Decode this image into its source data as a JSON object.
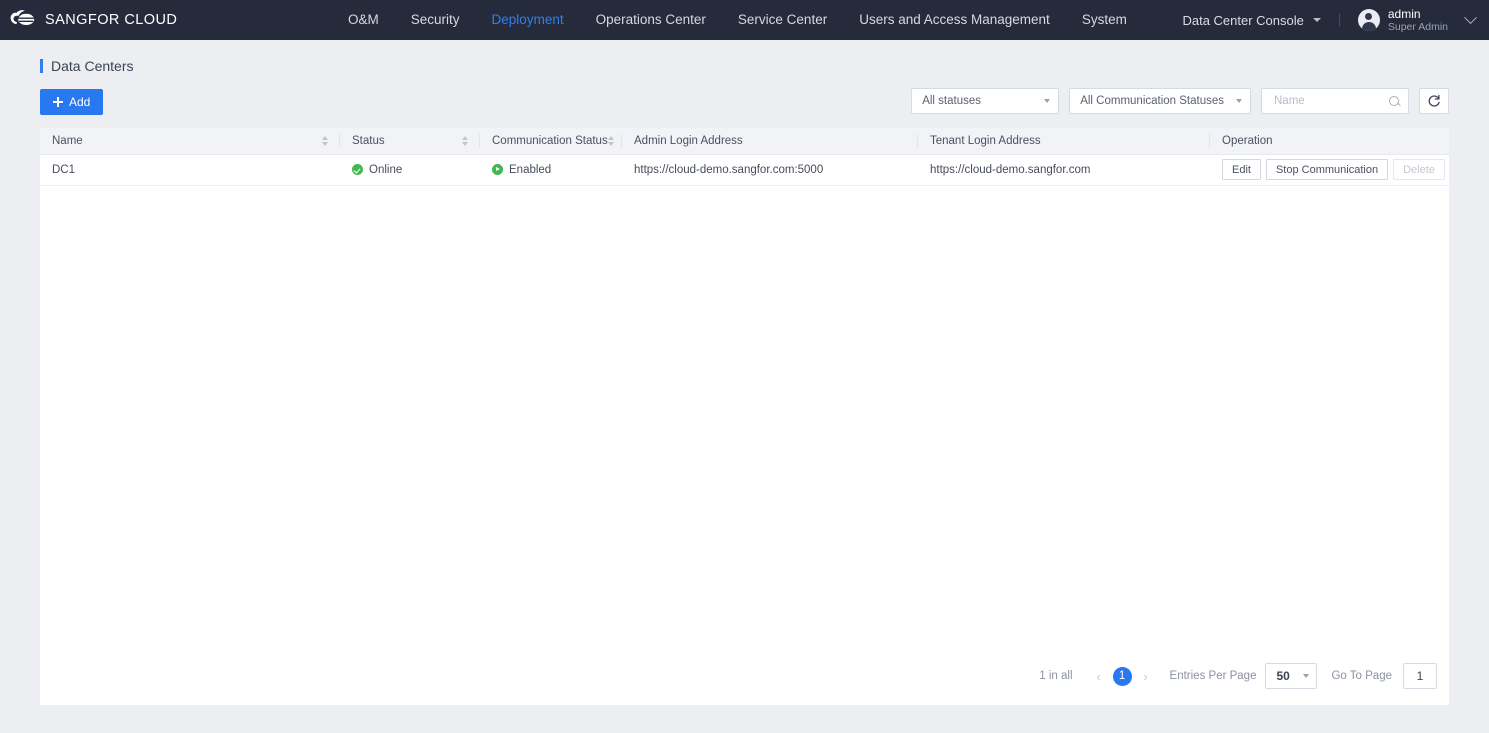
{
  "topbar": {
    "brand": "SANGFOR CLOUD",
    "logo_icon": "cloud-logo-icon",
    "nav": [
      {
        "label": "O&M",
        "active": false
      },
      {
        "label": "Security",
        "active": false
      },
      {
        "label": "Deployment",
        "active": true
      },
      {
        "label": "Operations Center",
        "active": false
      },
      {
        "label": "Service Center",
        "active": false
      },
      {
        "label": "Users and Access Management",
        "active": false
      },
      {
        "label": "System",
        "active": false
      }
    ],
    "console_label": "Data Center Console",
    "user": {
      "name": "admin",
      "role": "Super Admin"
    },
    "accent": "#2f7ff0",
    "background": "#252b3a"
  },
  "page": {
    "title": "Data Centers"
  },
  "toolbar": {
    "add_label": "Add",
    "status_filter": "All statuses",
    "communication_filter": "All Communication Statuses",
    "search_placeholder": "Name",
    "search_value": "",
    "refresh_icon": "refresh-icon"
  },
  "table": {
    "columns": [
      {
        "label": "Name",
        "sortable": true
      },
      {
        "label": "Status",
        "sortable": true
      },
      {
        "label": "Communication Status",
        "sortable": true
      },
      {
        "label": "Admin Login Address",
        "sortable": false
      },
      {
        "label": "Tenant Login Address",
        "sortable": false
      },
      {
        "label": "Operation",
        "sortable": false
      }
    ],
    "rows": [
      {
        "name": "DC1",
        "status": "Online",
        "status_icon": "check-circle-icon",
        "communication_status": "Enabled",
        "communication_icon": "play-circle-icon",
        "admin_login_address": "https://cloud-demo.sangfor.com:5000",
        "tenant_login_address": "https://cloud-demo.sangfor.com",
        "operations": [
          {
            "label": "Edit",
            "disabled": false
          },
          {
            "label": "Stop Communication",
            "disabled": false
          },
          {
            "label": "Delete",
            "disabled": true
          }
        ]
      }
    ],
    "status_color": "#3fb950"
  },
  "pagination": {
    "total_text": "1 in all",
    "prev_icon": "chevron-left-icon",
    "next_icon": "chevron-right-icon",
    "current_page": "1",
    "entries_label": "Entries Per Page",
    "entries_value": "50",
    "goto_label": "Go To Page",
    "goto_value": "1"
  }
}
